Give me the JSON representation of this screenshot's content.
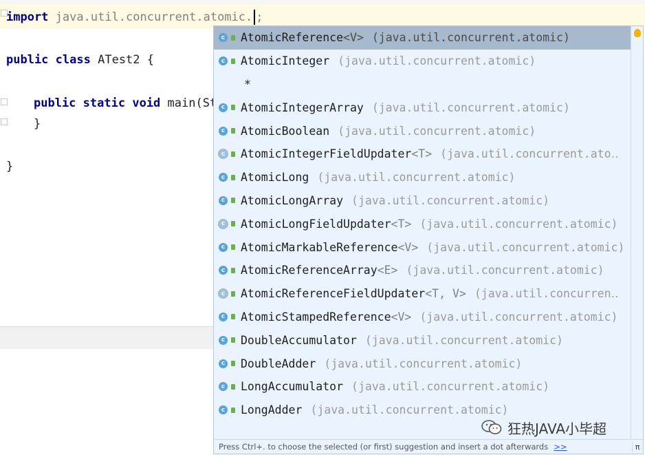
{
  "editor": {
    "import_keyword": "import",
    "import_path": "java.util.concurrent.atomic.",
    "import_semicolon": ";",
    "class_line": {
      "kw1": "public",
      "kw2": "class",
      "name": "ATest2 {"
    },
    "main_line": {
      "kw1": "public",
      "kw2": "static",
      "kw3": "void",
      "rest": "main(Str"
    },
    "close_brace_inner": "}",
    "close_brace_outer": "}"
  },
  "completion": {
    "items": [
      {
        "name": "AtomicReference",
        "generic": "<V>",
        "pkg": "(java.util.concurrent.atomic)",
        "icon": "class-icon",
        "selected": true
      },
      {
        "name": "AtomicInteger",
        "generic": "",
        "pkg": "(java.util.concurrent.atomic)",
        "icon": "class-icon"
      },
      {
        "name": "*",
        "generic": "",
        "pkg": "",
        "icon": "none"
      },
      {
        "name": "AtomicIntegerArray",
        "generic": "",
        "pkg": "(java.util.concurrent.atomic)",
        "icon": "class-icon"
      },
      {
        "name": "AtomicBoolean",
        "generic": "",
        "pkg": "(java.util.concurrent.atomic)",
        "icon": "class-icon"
      },
      {
        "name": "AtomicIntegerFieldUpdater",
        "generic": "<T>",
        "pkg": "(java.util.concurrent.ato‥",
        "icon": "abstract-class-icon"
      },
      {
        "name": "AtomicLong",
        "generic": "",
        "pkg": "(java.util.concurrent.atomic)",
        "icon": "class-icon"
      },
      {
        "name": "AtomicLongArray",
        "generic": "",
        "pkg": "(java.util.concurrent.atomic)",
        "icon": "class-icon"
      },
      {
        "name": "AtomicLongFieldUpdater",
        "generic": "<T>",
        "pkg": "(java.util.concurrent.atomic)",
        "icon": "abstract-class-icon"
      },
      {
        "name": "AtomicMarkableReference",
        "generic": "<V>",
        "pkg": "(java.util.concurrent.atomic)",
        "icon": "class-icon"
      },
      {
        "name": "AtomicReferenceArray",
        "generic": "<E>",
        "pkg": "(java.util.concurrent.atomic)",
        "icon": "class-icon"
      },
      {
        "name": "AtomicReferenceFieldUpdater",
        "generic": "<T, V>",
        "pkg": "(java.util.concurren‥",
        "icon": "abstract-class-icon"
      },
      {
        "name": "AtomicStampedReference",
        "generic": "<V>",
        "pkg": "(java.util.concurrent.atomic)",
        "icon": "class-icon"
      },
      {
        "name": "DoubleAccumulator",
        "generic": "",
        "pkg": "(java.util.concurrent.atomic)",
        "icon": "class-icon"
      },
      {
        "name": "DoubleAdder",
        "generic": "",
        "pkg": "(java.util.concurrent.atomic)",
        "icon": "class-icon"
      },
      {
        "name": "LongAccumulator",
        "generic": "",
        "pkg": "(java.util.concurrent.atomic)",
        "icon": "class-icon"
      },
      {
        "name": "LongAdder",
        "generic": "",
        "pkg": "(java.util.concurrent.atomic)",
        "icon": "class-icon"
      }
    ],
    "footer_text": "Press Ctrl+. to choose the selected (or first) suggestion and insert a dot afterwards",
    "footer_link": ">>",
    "pi_label": "π"
  },
  "watermark": {
    "text": "狂热JAVA小毕超",
    "icon": "wechat-icon"
  },
  "colors": {
    "selection": "#a7b9cd",
    "popup_bg": "#ebf4fe",
    "keyword": "#000080"
  }
}
